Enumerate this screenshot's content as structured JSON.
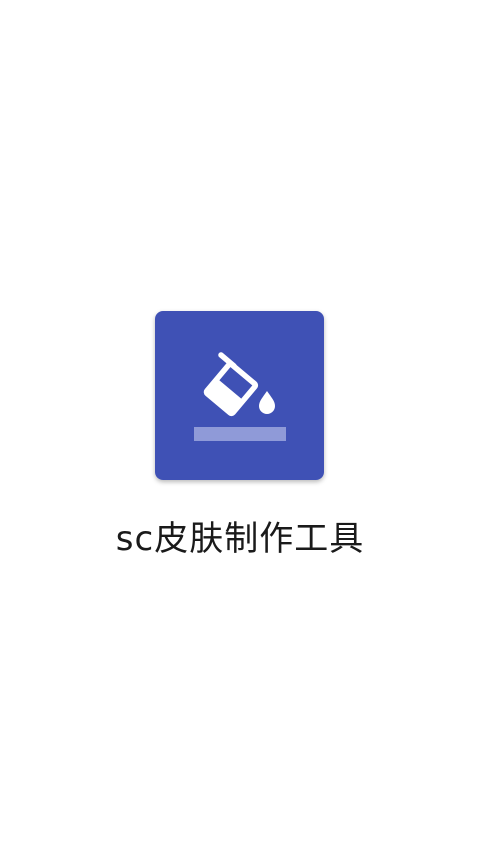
{
  "splash": {
    "app_name": "sc皮肤制作工具",
    "icon": "paint-bucket-icon"
  },
  "colors": {
    "background": "#ffffff",
    "icon_background": "#3f51b5",
    "icon_foreground": "#ffffff",
    "icon_bar": "#8f9ad8",
    "text": "#1a1a1a"
  }
}
